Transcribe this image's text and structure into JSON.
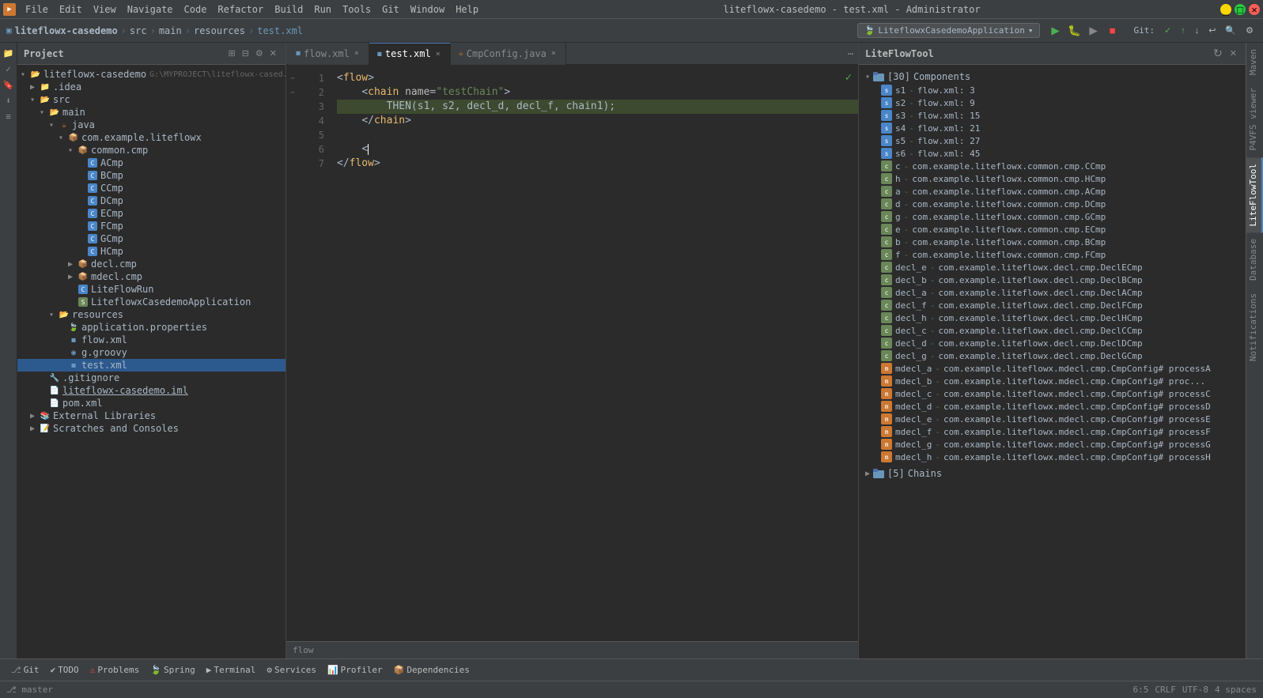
{
  "window": {
    "title": "liteflowx-casedemo - test.xml - Administrator"
  },
  "menu": {
    "items": [
      "File",
      "Edit",
      "View",
      "Navigate",
      "Code",
      "Refactor",
      "Build",
      "Run",
      "Tools",
      "Git",
      "Window",
      "Help"
    ]
  },
  "toolbar": {
    "project_name": "liteflowx-casedemo",
    "breadcrumb": [
      "src",
      "main",
      "resources",
      "test.xml"
    ],
    "run_config": "LiteflowxCasedemoApplication",
    "git_label": "Git:"
  },
  "project_panel": {
    "title": "Project",
    "root": "liteflowx-casedemo",
    "root_path": "G:\\MYPROJECT\\liteflowx-cased...",
    "tree": [
      {
        "id": "idea",
        "label": ".idea",
        "indent": 1,
        "type": "folder",
        "collapsed": true
      },
      {
        "id": "src",
        "label": "src",
        "indent": 1,
        "type": "folder",
        "collapsed": false
      },
      {
        "id": "main",
        "label": "main",
        "indent": 2,
        "type": "folder",
        "collapsed": false
      },
      {
        "id": "java",
        "label": "java",
        "indent": 3,
        "type": "folder",
        "collapsed": false
      },
      {
        "id": "com.example.liteflowx",
        "label": "com.example.liteflowx",
        "indent": 4,
        "type": "package",
        "collapsed": false
      },
      {
        "id": "common.cmp",
        "label": "common.cmp",
        "indent": 5,
        "type": "package",
        "collapsed": false
      },
      {
        "id": "ACmp",
        "label": "ACmp",
        "indent": 6,
        "type": "class"
      },
      {
        "id": "BCmp",
        "label": "BCmp",
        "indent": 6,
        "type": "class"
      },
      {
        "id": "CCmp",
        "label": "CCmp",
        "indent": 6,
        "type": "class"
      },
      {
        "id": "DCmp",
        "label": "DCmp",
        "indent": 6,
        "type": "class"
      },
      {
        "id": "ECmp",
        "label": "ECmp",
        "indent": 6,
        "type": "class"
      },
      {
        "id": "FCmp",
        "label": "FCmp",
        "indent": 6,
        "type": "class"
      },
      {
        "id": "GCmp",
        "label": "GCmp",
        "indent": 6,
        "type": "class"
      },
      {
        "id": "HCmp",
        "label": "HCmp",
        "indent": 6,
        "type": "class"
      },
      {
        "id": "decl.cmp",
        "label": "decl.cmp",
        "indent": 5,
        "type": "package",
        "collapsed": true
      },
      {
        "id": "mdecl.cmp",
        "label": "mdecl.cmp",
        "indent": 5,
        "type": "package",
        "collapsed": true
      },
      {
        "id": "LiteFlowRun",
        "label": "LiteFlowRun",
        "indent": 5,
        "type": "class"
      },
      {
        "id": "LiteflowxCasedemoApplication",
        "label": "LiteflowxCasedemoApplication",
        "indent": 5,
        "type": "class"
      },
      {
        "id": "resources",
        "label": "resources",
        "indent": 3,
        "type": "folder",
        "collapsed": false
      },
      {
        "id": "application.properties",
        "label": "application.properties",
        "indent": 4,
        "type": "properties"
      },
      {
        "id": "flow.xml",
        "label": "flow.xml",
        "indent": 4,
        "type": "xml"
      },
      {
        "id": "g.groovy",
        "label": "g.groovy",
        "indent": 4,
        "type": "groovy"
      },
      {
        "id": "test.xml",
        "label": "test.xml",
        "indent": 4,
        "type": "xml",
        "selected": true
      },
      {
        "id": ".gitignore",
        "label": ".gitignore",
        "indent": 2,
        "type": "git"
      },
      {
        "id": "liteflowx-casedemo.iml",
        "label": "liteflowx-casedemo.iml",
        "indent": 2,
        "type": "iml"
      },
      {
        "id": "pom.xml",
        "label": "pom.xml",
        "indent": 2,
        "type": "pom"
      },
      {
        "id": "External Libraries",
        "label": "External Libraries",
        "indent": 1,
        "type": "folder",
        "collapsed": true
      },
      {
        "id": "Scratches and Consoles",
        "label": "Scratches and Consoles",
        "indent": 1,
        "type": "folder",
        "collapsed": true
      }
    ]
  },
  "tabs": [
    {
      "id": "flow.xml",
      "label": "flow.xml",
      "active": false,
      "type": "xml"
    },
    {
      "id": "test.xml",
      "label": "test.xml",
      "active": true,
      "type": "xml"
    },
    {
      "id": "CmpConfig.java",
      "label": "CmpConfig.java",
      "active": false,
      "type": "java"
    }
  ],
  "editor": {
    "lines": [
      {
        "num": 1,
        "content": "<flow>",
        "highlight": false
      },
      {
        "num": 2,
        "content": "    <chain name=\"testChain\">",
        "highlight": false
      },
      {
        "num": 3,
        "content": "        THEN(s1, s2, decl_d, decl_f, chain1);",
        "highlight": true
      },
      {
        "num": 4,
        "content": "    </chain>",
        "highlight": false
      },
      {
        "num": 5,
        "content": "",
        "highlight": false
      },
      {
        "num": 6,
        "content": "    <",
        "highlight": false,
        "cursor": true
      },
      {
        "num": 7,
        "content": "</flow>",
        "highlight": false
      }
    ],
    "footer": "flow"
  },
  "right_panel": {
    "title": "LiteFlowTool",
    "sections": [
      {
        "id": "components",
        "label": "Components",
        "count": "[30]",
        "expanded": true,
        "items": [
          {
            "id": "s1",
            "label": "s1",
            "detail": "flow.xml: 3",
            "type": "s"
          },
          {
            "id": "s2",
            "label": "s2",
            "detail": "flow.xml: 9",
            "type": "s"
          },
          {
            "id": "s3",
            "label": "s3",
            "detail": "flow.xml: 15",
            "type": "s"
          },
          {
            "id": "s4",
            "label": "s4",
            "detail": "flow.xml: 21",
            "type": "s"
          },
          {
            "id": "s5",
            "label": "s5",
            "detail": "flow.xml: 27",
            "type": "s"
          },
          {
            "id": "s6",
            "label": "s6",
            "detail": "flow.xml: 45",
            "type": "s"
          },
          {
            "id": "c",
            "label": "c",
            "detail": "com.example.liteflowx.common.cmp.CCmp",
            "type": "c"
          },
          {
            "id": "h",
            "label": "h",
            "detail": "com.example.liteflowx.common.cmp.HCmp",
            "type": "c"
          },
          {
            "id": "a",
            "label": "a",
            "detail": "com.example.liteflowx.common.cmp.ACmp",
            "type": "c"
          },
          {
            "id": "d",
            "label": "d",
            "detail": "com.example.liteflowx.common.cmp.DCmp",
            "type": "c"
          },
          {
            "id": "g",
            "label": "g",
            "detail": "com.example.liteflowx.common.cmp.GCmp",
            "type": "c"
          },
          {
            "id": "e",
            "label": "e",
            "detail": "com.example.liteflowx.common.cmp.ECmp",
            "type": "c"
          },
          {
            "id": "b",
            "label": "b",
            "detail": "com.example.liteflowx.common.cmp.BCmp",
            "type": "c"
          },
          {
            "id": "f",
            "label": "f",
            "detail": "com.example.liteflowx.common.cmp.FCmp",
            "type": "c"
          },
          {
            "id": "decl_e",
            "label": "decl_e",
            "detail": "com.example.liteflowx.decl.cmp.DeclECmp",
            "type": "c"
          },
          {
            "id": "decl_b",
            "label": "decl_b",
            "detail": "com.example.liteflowx.decl.cmp.DeclBCmp",
            "type": "c"
          },
          {
            "id": "decl_a",
            "label": "decl_a",
            "detail": "com.example.liteflowx.decl.cmp.DeclACmp",
            "type": "c"
          },
          {
            "id": "decl_f",
            "label": "decl_f",
            "detail": "com.example.liteflowx.decl.cmp.DeclFCmp",
            "type": "c"
          },
          {
            "id": "decl_h",
            "label": "decl_h",
            "detail": "com.example.liteflowx.decl.cmp.DeclHCmp",
            "type": "c"
          },
          {
            "id": "decl_c",
            "label": "decl_c",
            "detail": "com.example.liteflowx.decl.cmp.DeclCCmp",
            "type": "c"
          },
          {
            "id": "decl_d",
            "label": "decl_d",
            "detail": "com.example.liteflowx.decl.cmp.DeclDCmp",
            "type": "c"
          },
          {
            "id": "decl_g",
            "label": "decl_g",
            "detail": "com.example.liteflowx.decl.cmp.DeclGCmp",
            "type": "c"
          },
          {
            "id": "mdecl_a",
            "label": "mdecl_a",
            "detail": "com.example.liteflowx.mdecl.cmp.CmpConfig# processA",
            "type": "m"
          },
          {
            "id": "mdecl_b",
            "label": "mdecl_b",
            "detail": "com.example.liteflowx.mdecl.cmp.CmpConfig# proc...",
            "type": "m"
          },
          {
            "id": "mdecl_c",
            "label": "mdecl_c",
            "detail": "com.example.liteflowx.mdecl.cmp.CmpConfig# processC",
            "type": "m"
          },
          {
            "id": "mdecl_d",
            "label": "mdecl_d",
            "detail": "com.example.liteflowx.mdecl.cmp.CmpConfig# processD",
            "type": "m"
          },
          {
            "id": "mdecl_e",
            "label": "mdecl_e",
            "detail": "com.example.liteflowx.mdecl.cmp.CmpConfig# processE",
            "type": "m"
          },
          {
            "id": "mdecl_f",
            "label": "mdecl_f",
            "detail": "com.example.liteflowx.mdecl.cmp.CmpConfig# processF",
            "type": "m"
          },
          {
            "id": "mdecl_g",
            "label": "mdecl_g",
            "detail": "com.example.liteflowx.mdecl.cmp.CmpConfig# processG",
            "type": "m"
          },
          {
            "id": "mdecl_h",
            "label": "mdecl_h",
            "detail": "com.example.liteflowx.mdecl.cmp.CmpConfig# processH",
            "type": "m"
          }
        ]
      },
      {
        "id": "chains",
        "label": "Chains",
        "count": "[5]",
        "expanded": false,
        "items": []
      }
    ]
  },
  "right_tabs": [
    "Maven",
    "P4VFS viewer",
    "LiteFlowTool",
    "Database",
    "Notifications"
  ],
  "bottom_tabs": [
    {
      "id": "git",
      "label": "Git",
      "icon": "git"
    },
    {
      "id": "todo",
      "label": "TODO",
      "icon": "todo"
    },
    {
      "id": "problems",
      "label": "Problems",
      "icon": "problems"
    },
    {
      "id": "spring",
      "label": "Spring",
      "icon": "spring"
    },
    {
      "id": "terminal",
      "label": "Terminal",
      "icon": "terminal"
    },
    {
      "id": "services",
      "label": "Services",
      "icon": "services"
    },
    {
      "id": "profiler",
      "label": "Profiler",
      "icon": "profiler"
    },
    {
      "id": "dependencies",
      "label": "Dependencies",
      "icon": "dependencies"
    }
  ],
  "status_bar": {
    "position": "6:5",
    "line_endings": "CRLF",
    "encoding": "UTF-8",
    "indent": "4 spaces",
    "branch": "master"
  }
}
